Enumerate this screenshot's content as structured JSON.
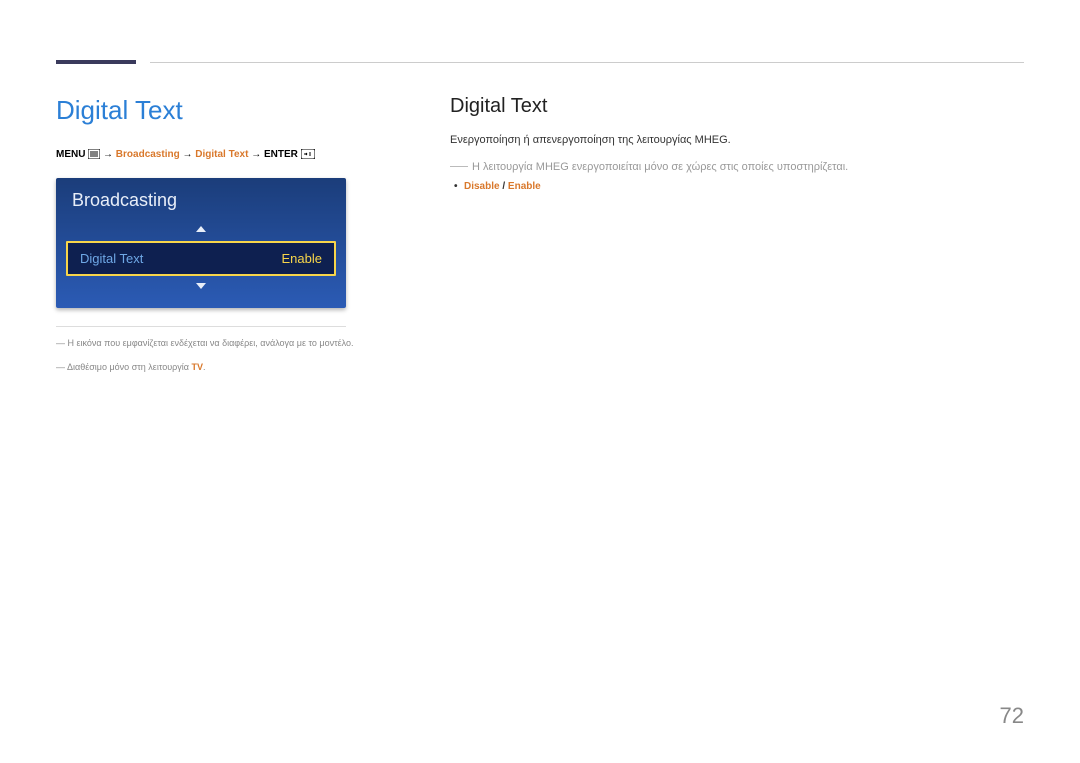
{
  "left": {
    "title": "Digital Text",
    "breadcrumb": {
      "menu": "MENU",
      "arrow": "→",
      "broadcasting": "Broadcasting",
      "digital_text": "Digital Text",
      "enter": "ENTER"
    },
    "menu_box": {
      "header": "Broadcasting",
      "row_label": "Digital Text",
      "row_value": "Enable"
    },
    "footnote1_prefix": "―  ",
    "footnote1": "Η εικόνα που εμφανίζεται ενδέχεται να διαφέρει, ανάλογα με το μοντέλο.",
    "footnote2_prefix": "―  ",
    "footnote2_a": "Διαθέσιμο μόνο στη λειτουργία ",
    "footnote2_tv": "TV",
    "footnote2_b": "."
  },
  "right": {
    "title": "Digital Text",
    "para1": "Ενεργοποίηση ή απενεργοποίηση της λειτουργίας MHEG.",
    "note1": "Η λειτουργία MHEG ενεργοποιείται μόνο σε χώρες στις οποίες υποστηρίζεται.",
    "bullet": {
      "disable": "Disable",
      "sep": " / ",
      "enable": "Enable"
    }
  },
  "page_number": "72"
}
